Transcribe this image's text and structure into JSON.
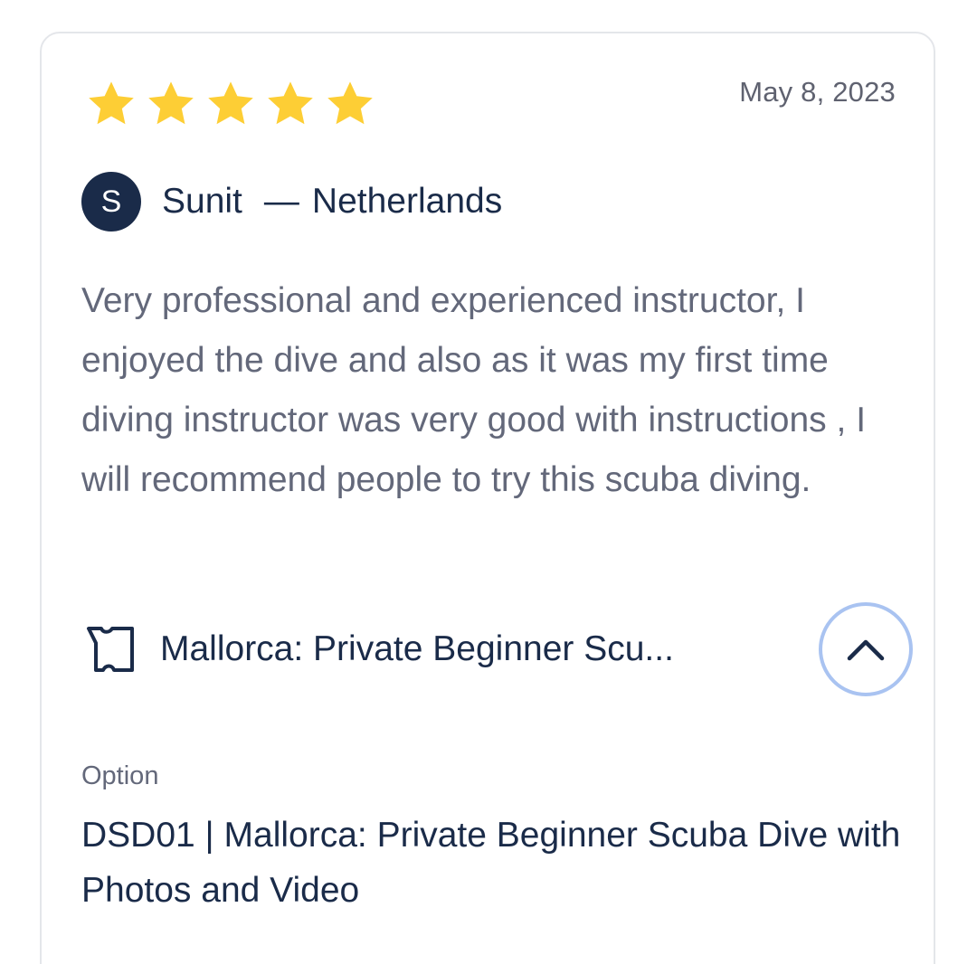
{
  "review": {
    "rating": 5,
    "rating_max": 5,
    "date": "May 8, 2023",
    "reviewer": {
      "initial": "S",
      "name": "Sunit",
      "separator": "—",
      "country": "Netherlands"
    },
    "text": "Very professional and experienced instructor, I enjoyed the dive and also as it was my first time diving instructor was very good with instructions , I will recommend people to try this scuba diving.",
    "activity": {
      "icon": "ticket-icon",
      "title": "Mallorca: Private Beginner Scu..."
    },
    "toggle": {
      "icon": "chevron-up-icon",
      "state": "expanded"
    },
    "option": {
      "label": "Option",
      "value": "DSD01 | Mallorca: Private Beginner Scuba Dive with Photos and Video"
    }
  },
  "colors": {
    "star": "#fdce35",
    "navy": "#1a2b49",
    "body_text": "#63687a",
    "button_ring": "#a9c3f1",
    "card_border": "#e4e6ea"
  }
}
